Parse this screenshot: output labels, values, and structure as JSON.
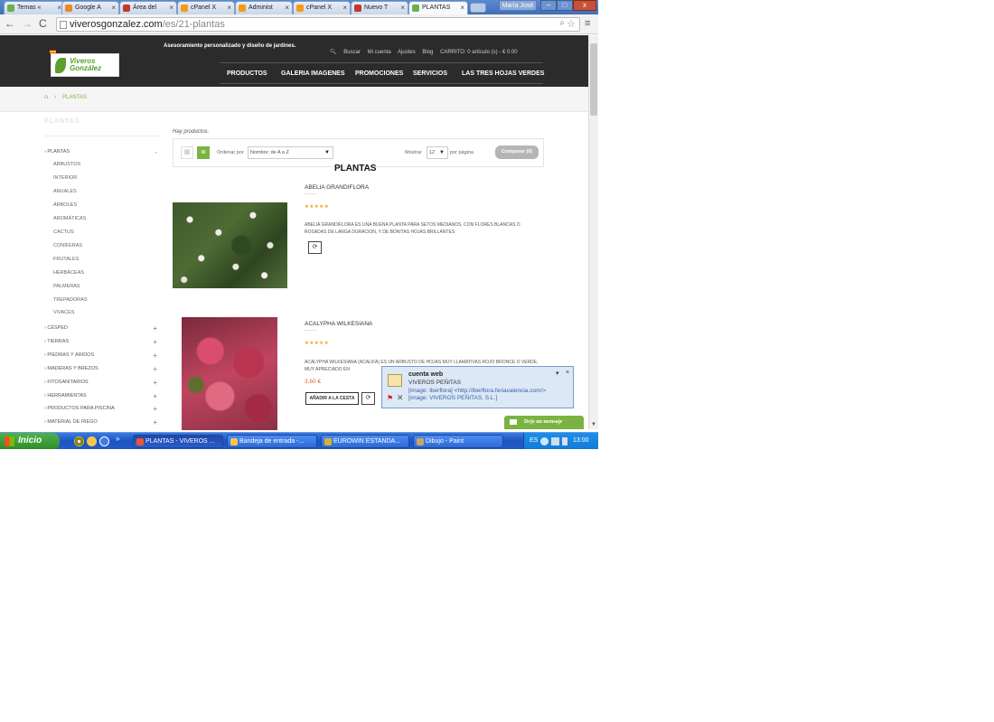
{
  "browser": {
    "tabs": [
      {
        "label": "Temas «"
      },
      {
        "label": "Google A"
      },
      {
        "label": "Área del"
      },
      {
        "label": "cPanel X"
      },
      {
        "label": "Administ"
      },
      {
        "label": "cPanel X"
      },
      {
        "label": "Nuevo T"
      },
      {
        "label": "PLANTAS"
      }
    ],
    "user_label": "María José",
    "url_host": "viverosgonzalez.com",
    "url_path": "/es/21-plantas"
  },
  "site": {
    "logo_text": "Viveros González",
    "tagline": "Asesoramiento personalizado y diseño de jardines.",
    "header_links": [
      "Buscar",
      "Mi cuenta",
      "Ajustes",
      "Blog",
      "CARRITO: 0 artículo (s) - € 0.00"
    ],
    "nav": [
      "PRODUCTOS",
      "GALERIA IMAGENES",
      "PROMOCIONES",
      "SERVICIOS",
      "LAS TRES HOJAS VERDES"
    ],
    "breadcrumb_current": "PLANTAS",
    "sidebar_title": "PLANTAS",
    "categories_top": "PLANTAS",
    "subcategories": [
      "ARBUSTOS",
      "INTERIOR",
      "ANUALES",
      "ÁRBOLES",
      "AROMÁTICAS",
      "CACTUS",
      "CONÍFERAS",
      "FRUTALES",
      "HERBÁCEAS",
      "PALMERAS",
      "TREPADORAS",
      "VIVACES"
    ],
    "categories": [
      "CÉSPED",
      "TIERRAS",
      "PIEDRAS Y ÁRIDOS",
      "MADERAS Y BREZOS",
      "FITOSANITARIOS",
      "HERRAMIENTAS",
      "PRODUCTOS PARA PISCINA",
      "MATERIAL DE RIEGO"
    ],
    "hay_productos": "Hay productos.",
    "sort_label": "Ordenar por",
    "sort_value": "Nombre: de A a Z",
    "show_label": "Mostrar",
    "show_value": "12",
    "per_page": "por página",
    "compare": "Comparar (0)",
    "heading": "PLANTAS",
    "products": [
      {
        "name": "ABELIA GRANDIFLORA",
        "rating": "★★★★★",
        "desc": "ABELIA GRANDIFLORA ES UNA BUENA PLANTA PARA SETOS MEDIANOS, CON FLORES BLANCAS O ROSADAS DE LARGA DURACION, Y DE BONITAS HOJAS BRILLANTES"
      },
      {
        "name": "ACALYPHA WILKESIANA",
        "rating": "★★★★★",
        "desc": "ACALYPHA WILKESIANA (ACALIFA) ES UN ARBUSTO DE HOJAS MUY LLAMATIVAS ROJO BRONCE O VERDE, MUY APRECIADO EN",
        "price": "3,60 €",
        "cart": "AÑADIR A LA CESTA"
      }
    ],
    "message_button": "Deje un mensaje"
  },
  "notification": {
    "title": "cuenta web",
    "sender": "VIVEROS PEÑITAS",
    "line1": "[image: Iberflora] <http://iberflora.feriavalencia.com/>",
    "line2": "[image: VIVEROS PEÑITAS, S.L.]"
  },
  "taskbar": {
    "start": "Inicio",
    "items": [
      "PLANTAS - VIVEROS ...",
      "Bandeja de entrada -...",
      "EUROWIN ESTANDA...",
      "Dibujo - Paint"
    ],
    "lang": "ES",
    "time": "13:00"
  }
}
